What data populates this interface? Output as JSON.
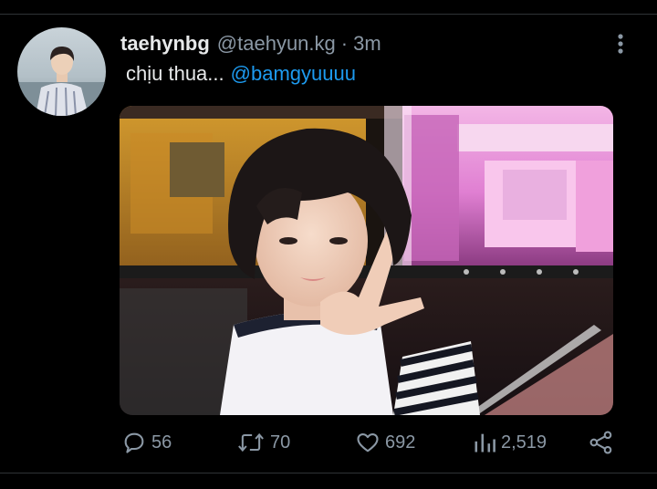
{
  "tweet": {
    "display_name": "taehynbg",
    "handle": "@taehyun.kg",
    "separator": "·",
    "time": "3m",
    "text": "chịu thua...",
    "mention": "@bamgyuuuu"
  },
  "actions": {
    "reply_count": "56",
    "retweet_count": "70",
    "like_count": "692",
    "view_count": "2,519"
  },
  "icons": {
    "reply": "speech-bubble-icon",
    "retweet": "retweet-arrows-icon",
    "like": "heart-icon",
    "views": "bar-chart-icon",
    "share": "share-nodes-icon",
    "more": "vertical-ellipsis-icon"
  },
  "colors": {
    "background": "#000000",
    "text": "#e7e9ea",
    "secondary": "#8b98a5",
    "accent": "#1d9bf0"
  }
}
